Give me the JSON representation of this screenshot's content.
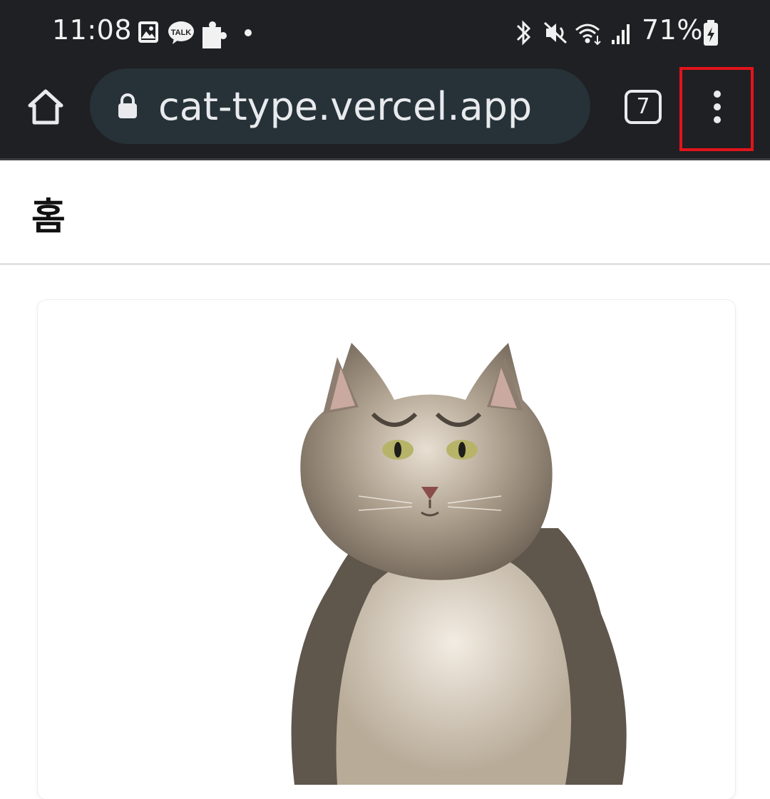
{
  "status_bar": {
    "time": "11:08",
    "battery_percent": "71%",
    "left_icons": [
      "gallery-icon",
      "kakaotalk-icon",
      "puzzle-icon",
      "dot-icon"
    ],
    "right_icons": [
      "bluetooth-icon",
      "mute-icon",
      "wifi-icon",
      "signal-icon",
      "battery-icon"
    ],
    "kakaotalk_label": "TALK"
  },
  "browser": {
    "url": "cat-type.vercel.app",
    "tab_count": "7",
    "icons": [
      "home-icon",
      "lock-icon",
      "tab-switcher-icon",
      "more-vert-icon"
    ]
  },
  "page": {
    "title": "홈"
  },
  "card": {
    "image": "cat-photo"
  },
  "colors": {
    "toolbar_bg": "#1f2023",
    "url_pill_bg": "#263238",
    "highlight": "#e3141b"
  }
}
